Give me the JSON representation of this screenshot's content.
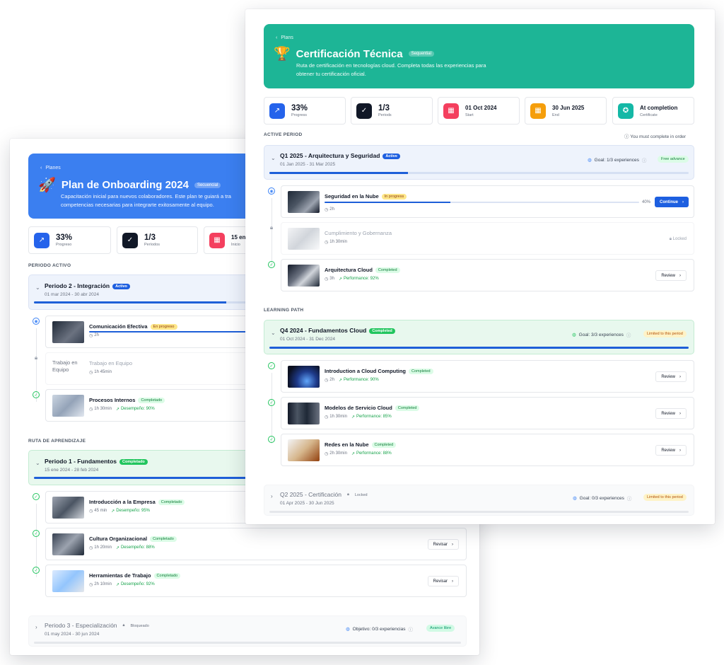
{
  "back": {
    "hero": {
      "back": "Planes",
      "title": "Plan de Onboarding 2024",
      "tag": "Secuencial",
      "desc_1": "Capacitación inicial para nuevos colaboradores. Este plan te guiará a tra",
      "desc_2": "competencias necesarias para integrarte exitosamente al equipo."
    },
    "stats": [
      {
        "value": "33%",
        "label": "Progreso",
        "color": "#2563eb"
      },
      {
        "value": "1/3",
        "label": "Períodos",
        "color": "#111827"
      },
      {
        "value": "15 ene",
        "label": "Inicio",
        "color": "#f43f5e"
      }
    ],
    "active_section": "PERIODO ACTIVO",
    "active_period": {
      "title": "Periodo 2 - Integración",
      "badge": "Activo",
      "dates": "01 mar 2024 - 30 abr 2024",
      "progress": 0.45
    },
    "active_items": [
      {
        "title": "Comunicación Efectiva",
        "badge": "En progreso",
        "duration": "2h"
      },
      {
        "title": "Trabajo en Equipo",
        "thumb_alt": "Trabajo en Equipo",
        "duration": "1h 45min"
      },
      {
        "title": "Procesos Internos",
        "badge": "Completado",
        "duration": "1h 30min",
        "perf": "Desempeño: 90%"
      }
    ],
    "path_section": "RUTA DE APRENDIZAJE",
    "done_period": {
      "title": "Periodo 1 - Fundamentos",
      "badge": "Completado",
      "dates": "15 ene 2024 - 28 feb 2024",
      "progress": 1
    },
    "done_items": [
      {
        "title": "Introducción a la Empresa",
        "badge": "Completado",
        "duration": "45 min",
        "perf": "Desempeño: 95%"
      },
      {
        "title": "Cultura Organizacional",
        "badge": "Completado",
        "duration": "1h 20min",
        "perf": "Desempeño: 88%",
        "button": "Revisar"
      },
      {
        "title": "Herramientas de Trabajo",
        "badge": "Completado",
        "duration": "2h 10min",
        "perf": "Desempeño: 92%",
        "button": "Revisar"
      }
    ],
    "locked_period": {
      "title": "Periodo 3 - Especialización",
      "badge": "Bloqueado",
      "dates": "01 may 2024 - 30 jun 2024",
      "goal": "Objetivo: 0/3 experiencias",
      "pill": "Avance libre"
    }
  },
  "front": {
    "hero": {
      "back": "Plans",
      "title": "Certificación Técnica",
      "tag": "Sequential",
      "desc_1": "Ruta de certificación en tecnologías cloud. Completa todas las experiencias para",
      "desc_2": "obtener tu certificación oficial."
    },
    "stats": [
      {
        "value": "33%",
        "label": "Progress",
        "color": "#2563eb"
      },
      {
        "value": "1/3",
        "label": "Periods",
        "color": "#111827"
      },
      {
        "value": "01 Oct 2024",
        "label": "Start",
        "color": "#f43f5e"
      },
      {
        "value": "30 Jun 2025",
        "label": "End",
        "color": "#f59e0b"
      },
      {
        "value": "At completion",
        "label": "Certificate",
        "color": "#14b8a6"
      }
    ],
    "active_section": "ACTIVE PERIOD",
    "order_hint": "You must complete in order",
    "active_period": {
      "title": "Q1 2025 - Arquitectura y Seguridad",
      "badge": "Active",
      "dates": "01 Jan 2025 - 31 Mar 2025",
      "goal": "Goal: 1/3 experiences",
      "pill": "Free advance",
      "progress": 0.33
    },
    "active_items": [
      {
        "title": "Seguridad en la Nube",
        "badge": "In progress",
        "duration": "2h",
        "progress_text": "40%",
        "progress": 0.4,
        "button": "Continue"
      },
      {
        "title": "Cumplimiento y Gobernanza",
        "duration": "1h 30min",
        "locked": "Locked"
      },
      {
        "title": "Arquitectura Cloud",
        "badge": "Completed",
        "duration": "3h",
        "perf": "Performance: 92%",
        "button": "Review"
      }
    ],
    "path_section": "LEARNING PATH",
    "done_period": {
      "title": "Q4 2024 - Fundamentos Cloud",
      "badge": "Completed",
      "dates": "01 Oct 2024 - 31 Dec 2024",
      "goal": "Goal: 3/3 experiences",
      "pill": "Limited to this period",
      "progress": 1
    },
    "done_items": [
      {
        "title": "Introduction a Cloud Computing",
        "badge": "Completed",
        "duration": "2h",
        "perf": "Performance: 90%",
        "button": "Review"
      },
      {
        "title": "Modelos de Servicio Cloud",
        "badge": "Completed",
        "duration": "1h 30min",
        "perf": "Performance: 85%",
        "button": "Review"
      },
      {
        "title": "Redes en la Nube",
        "badge": "Completed",
        "duration": "2h 30min",
        "perf": "Performance: 88%",
        "button": "Review"
      }
    ],
    "locked_period": {
      "title": "Q2 2025 - Certificación",
      "badge": "Locked",
      "dates": "01 Apr 2025 - 30 Jun 2025",
      "goal": "Goal: 0/3 experiences",
      "pill": "Limited to this period"
    }
  }
}
